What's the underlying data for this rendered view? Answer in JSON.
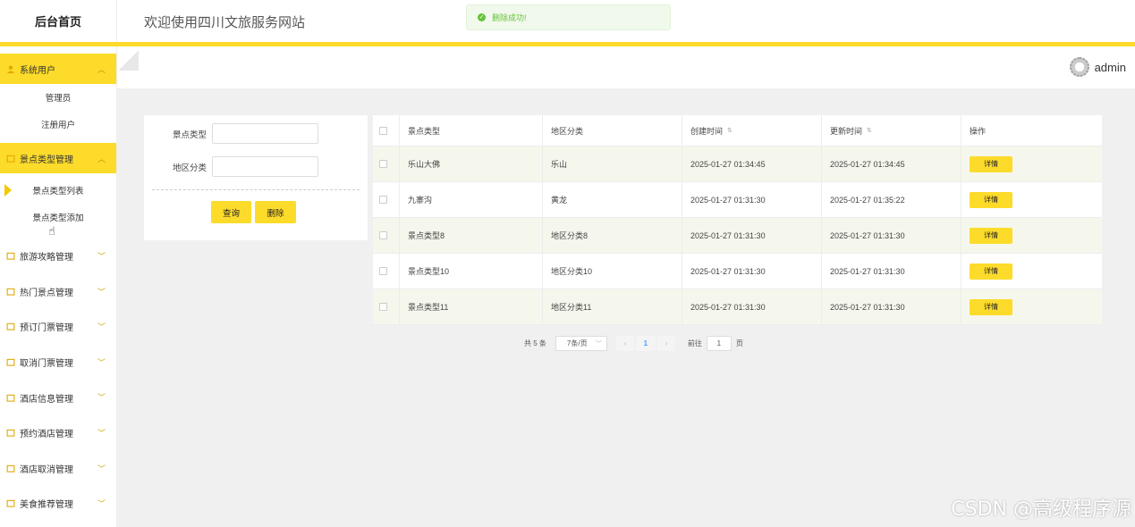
{
  "brand": "后台首页",
  "header": {
    "title": "欢迎使用四川文旅服务网站"
  },
  "toast": {
    "message": "删除成功!"
  },
  "user": {
    "name": "admin"
  },
  "sidebar": {
    "groups": [
      {
        "label": "系统用户",
        "icon": "user-icon",
        "active": true,
        "children": [
          "管理员",
          "注册用户"
        ]
      },
      {
        "label": "景点类型管理",
        "icon": "folder-icon",
        "active": true,
        "children": [
          "景点类型列表",
          "景点类型添加"
        ]
      },
      {
        "label": "旅游攻略管理",
        "icon": "folder-icon"
      },
      {
        "label": "热门景点管理",
        "icon": "folder-icon"
      },
      {
        "label": "预订门票管理",
        "icon": "folder-icon"
      },
      {
        "label": "取消门票管理",
        "icon": "folder-icon"
      },
      {
        "label": "酒店信息管理",
        "icon": "folder-icon"
      },
      {
        "label": "预约酒店管理",
        "icon": "folder-icon"
      },
      {
        "label": "酒店取消管理",
        "icon": "folder-icon"
      },
      {
        "label": "美食推荐管理",
        "icon": "folder-icon"
      }
    ]
  },
  "search": {
    "type_label": "景点类型",
    "region_label": "地区分类",
    "type_value": "",
    "region_value": "",
    "query_button": "查询",
    "delete_button": "删除"
  },
  "table": {
    "columns": [
      "景点类型",
      "地区分类",
      "创建时间",
      "更新时间",
      "操作"
    ],
    "rows": [
      {
        "type": "乐山大佛",
        "region": "乐山",
        "created": "2025-01-27 01:34:45",
        "updated": "2025-01-27 01:34:45",
        "action": "详情"
      },
      {
        "type": "九寨沟",
        "region": "黄龙",
        "created": "2025-01-27 01:31:30",
        "updated": "2025-01-27 01:35:22",
        "action": "详情"
      },
      {
        "type": "景点类型8",
        "region": "地区分类8",
        "created": "2025-01-27 01:31:30",
        "updated": "2025-01-27 01:31:30",
        "action": "详情"
      },
      {
        "type": "景点类型10",
        "region": "地区分类10",
        "created": "2025-01-27 01:31:30",
        "updated": "2025-01-27 01:31:30",
        "action": "详情"
      },
      {
        "type": "景点类型11",
        "region": "地区分类11",
        "created": "2025-01-27 01:31:30",
        "updated": "2025-01-27 01:31:30",
        "action": "详情"
      }
    ]
  },
  "pagination": {
    "total": "共 5 条",
    "page_size": "7条/页",
    "current_page": "1",
    "goto_label": "前往",
    "goto_value": "1",
    "page_suffix": "页"
  },
  "watermark": "CSDN @高级程序源",
  "colors": {
    "accent": "#fddb2a",
    "success": "#67c23a",
    "row_alt": "#f5f7ec"
  }
}
